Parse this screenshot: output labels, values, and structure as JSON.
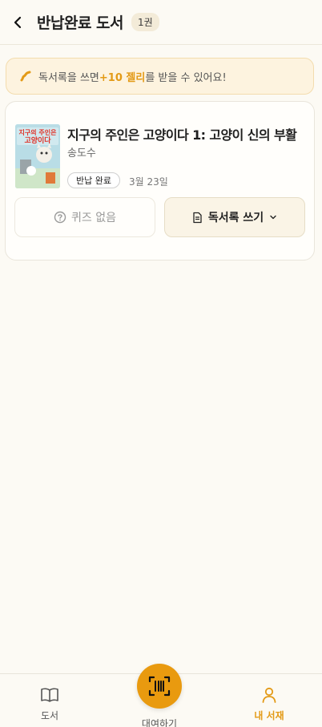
{
  "header": {
    "title": "반납완료 도서",
    "count": "1권"
  },
  "banner": {
    "prefix": "독서록을 쓰면 ",
    "highlight": "+10 젤리",
    "suffix": "를 받을 수 있어요!"
  },
  "book": {
    "title": "지구의 주인은 고양이다 1: 고양이 신의 부활",
    "author": "송도수",
    "status": "반납 완료",
    "date": "3월 23일",
    "cover_title_lines": [
      "지구의 주인은",
      "고양이다"
    ]
  },
  "actions": {
    "quiz_label": "퀴즈 없음",
    "write_label": "독서록 쓰기"
  },
  "tabbar": {
    "books_label": "도서",
    "borrow_label": "대여하기",
    "shelf_label": "내 서재"
  },
  "colors": {
    "accent": "#e99a0f",
    "background": "#fcfaf4"
  }
}
